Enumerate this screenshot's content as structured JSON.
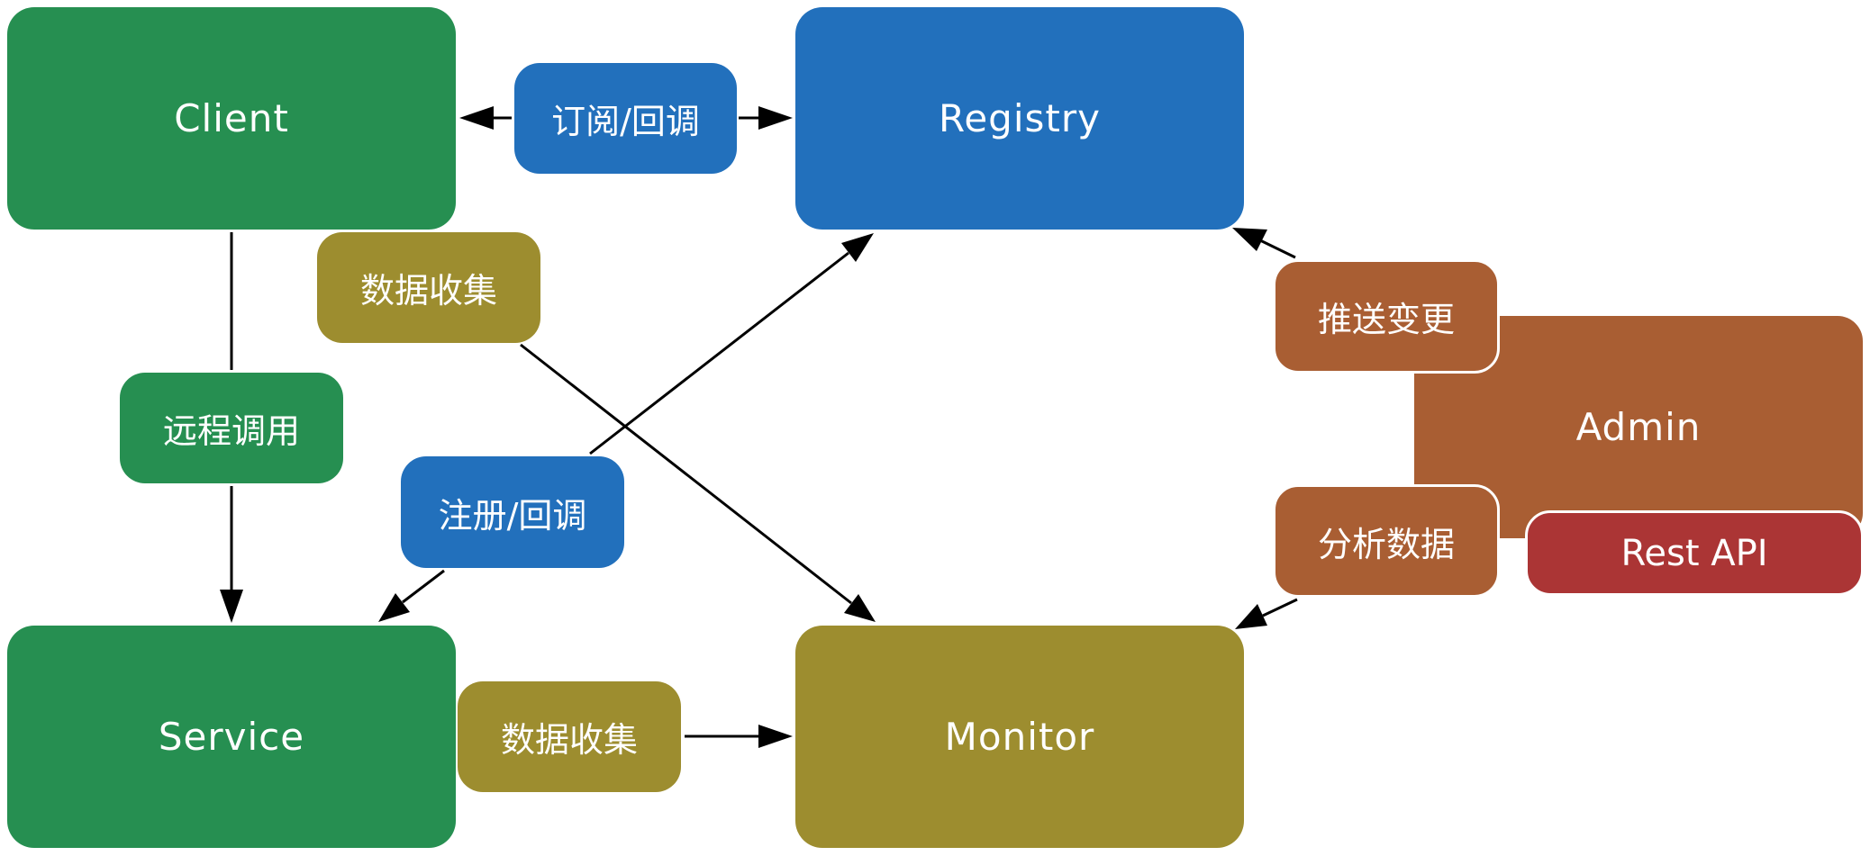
{
  "nodes": {
    "client": "Client",
    "registry": "Registry",
    "service": "Service",
    "monitor": "Monitor",
    "admin": "Admin",
    "rest_api": "Rest API"
  },
  "edges": {
    "subscribe_callback": "订阅/回调",
    "data_collect_client": "数据收集",
    "remote_call": "远程调用",
    "register_callback": "注册/回调",
    "data_collect_service": "数据收集",
    "push_changes": "推送变更",
    "analyze_data": "分析数据"
  },
  "colors": {
    "client_service": "#268f51",
    "registry_register": "#2270bc",
    "monitor_collect": "#9d8d2f",
    "admin": "#a95e33",
    "rest_api": "#ab3535",
    "arrow": "#000000"
  }
}
